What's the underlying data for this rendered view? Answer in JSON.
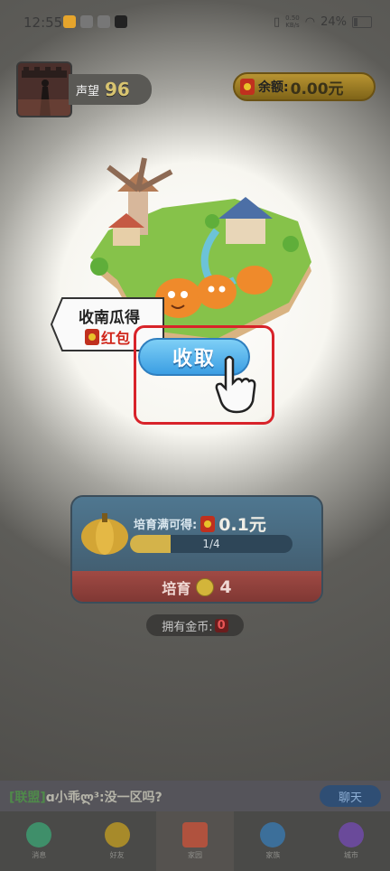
{
  "status_bar": {
    "time": "12:55",
    "network_speed": "0.50\nKB/s",
    "battery": "24%"
  },
  "profile": {
    "reputation_label": "声望",
    "reputation_value": "96"
  },
  "wallet": {
    "balance_label": "余额:",
    "balance_value": "0.00元"
  },
  "harvest": {
    "bubble_line1": "收南瓜得",
    "bubble_line2": "红包",
    "collect_label": "收取"
  },
  "grow_card": {
    "reward_label": "培育满可得:",
    "reward_value": "0.1元",
    "progress_text": "1/4",
    "progress_fraction": 0.25,
    "grow_label": "培育",
    "grow_cost": "4"
  },
  "coins": {
    "label": "拥有金币:",
    "value": "0"
  },
  "chat": {
    "tag": "[联盟]",
    "message": "ɑ小乖ლ³:没一区吗?",
    "button_label": "聊天"
  },
  "nav": {
    "items": [
      {
        "label": "消息",
        "icon": "message-icon",
        "color": "#3f8f6a"
      },
      {
        "label": "好友",
        "icon": "friend-icon",
        "color": "#a78a2a"
      },
      {
        "label": "家园",
        "icon": "home-icon",
        "color": "#b0523e"
      },
      {
        "label": "家族",
        "icon": "family-icon",
        "color": "#3c6f9a"
      },
      {
        "label": "城市",
        "icon": "city-icon",
        "color": "#6a4a9a"
      }
    ],
    "active_index": 2
  }
}
